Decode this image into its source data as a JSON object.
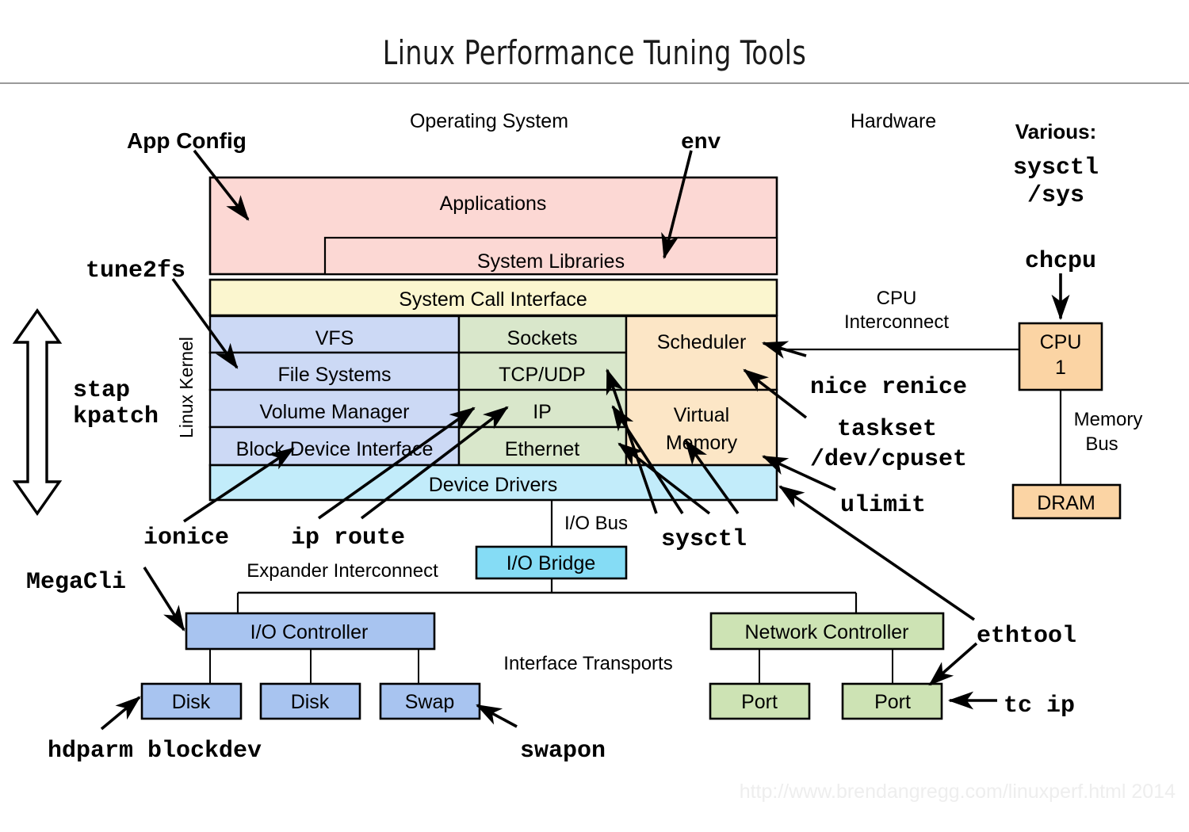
{
  "title": "Linux Performance Tuning Tools",
  "footer": "http://www.brendangregg.com/linuxperf.html 2014",
  "colors": {
    "applications": "#fcd8d4",
    "syscall": "#fbf6cf",
    "kernel_blue": "#ccd9f5",
    "kernel_green": "#d9e7cb",
    "kernel_orange": "#fce6c6",
    "device_drivers": "#c2ecfa",
    "io_blue": "#a8c4f0",
    "net_green": "#cde3b4",
    "cpu_orange": "#fbd4a4",
    "bridge_cyan": "#85dcf5",
    "stroke": "#000000",
    "footer_text": "#eeeeee",
    "rule": "#9a9a9a"
  },
  "section_labels": {
    "operating_system": "Operating System",
    "hardware": "Hardware",
    "linux_kernel": "Linux Kernel",
    "cpu_interconnect": "CPU\nInterconnect",
    "cpu_interconnect_line1": "CPU",
    "cpu_interconnect_line2": "Interconnect",
    "memory_bus_line1": "Memory",
    "memory_bus_line2": "Bus",
    "io_bus": "I/O Bus",
    "expander_interconnect": "Expander Interconnect",
    "interface_transports": "Interface Transports"
  },
  "stack_boxes": {
    "applications": "Applications",
    "system_libraries": "System Libraries",
    "system_call_interface": "System Call Interface",
    "vfs": "VFS",
    "file_systems": "File Systems",
    "volume_manager": "Volume Manager",
    "block_device_interface": "Block Device Interface",
    "sockets": "Sockets",
    "tcp_udp": "TCP/UDP",
    "ip": "IP",
    "ethernet": "Ethernet",
    "scheduler": "Scheduler",
    "virtual_memory_line1": "Virtual",
    "virtual_memory_line2": "Memory",
    "device_drivers": "Device Drivers"
  },
  "hardware_boxes": {
    "cpu_line1": "CPU",
    "cpu_line2": "1",
    "dram": "DRAM",
    "io_bridge": "I/O Bridge",
    "io_controller": "I/O Controller",
    "disk1": "Disk",
    "disk2": "Disk",
    "swap": "Swap",
    "network_controller": "Network Controller",
    "port1": "Port",
    "port2": "Port"
  },
  "tools": {
    "app_config": "App Config",
    "env": "env",
    "various": "Various:",
    "sysctl_sys_line1": "sysctl",
    "sysctl_sys_line2": "/sys",
    "chcpu": "chcpu",
    "tune2fs": "tune2fs",
    "stap": "stap",
    "kpatch": "kpatch",
    "nice_renice": "nice renice",
    "taskset": "taskset",
    "dev_cpuset": "/dev/cpuset",
    "ulimit": "ulimit",
    "ionice": "ionice",
    "ip_route": "ip route",
    "sysctl": "sysctl",
    "ethtool": "ethtool",
    "megacli": "MegaCli",
    "hdparm_blockdev": "hdparm blockdev",
    "swapon": "swapon",
    "tc_ip": "tc ip"
  }
}
